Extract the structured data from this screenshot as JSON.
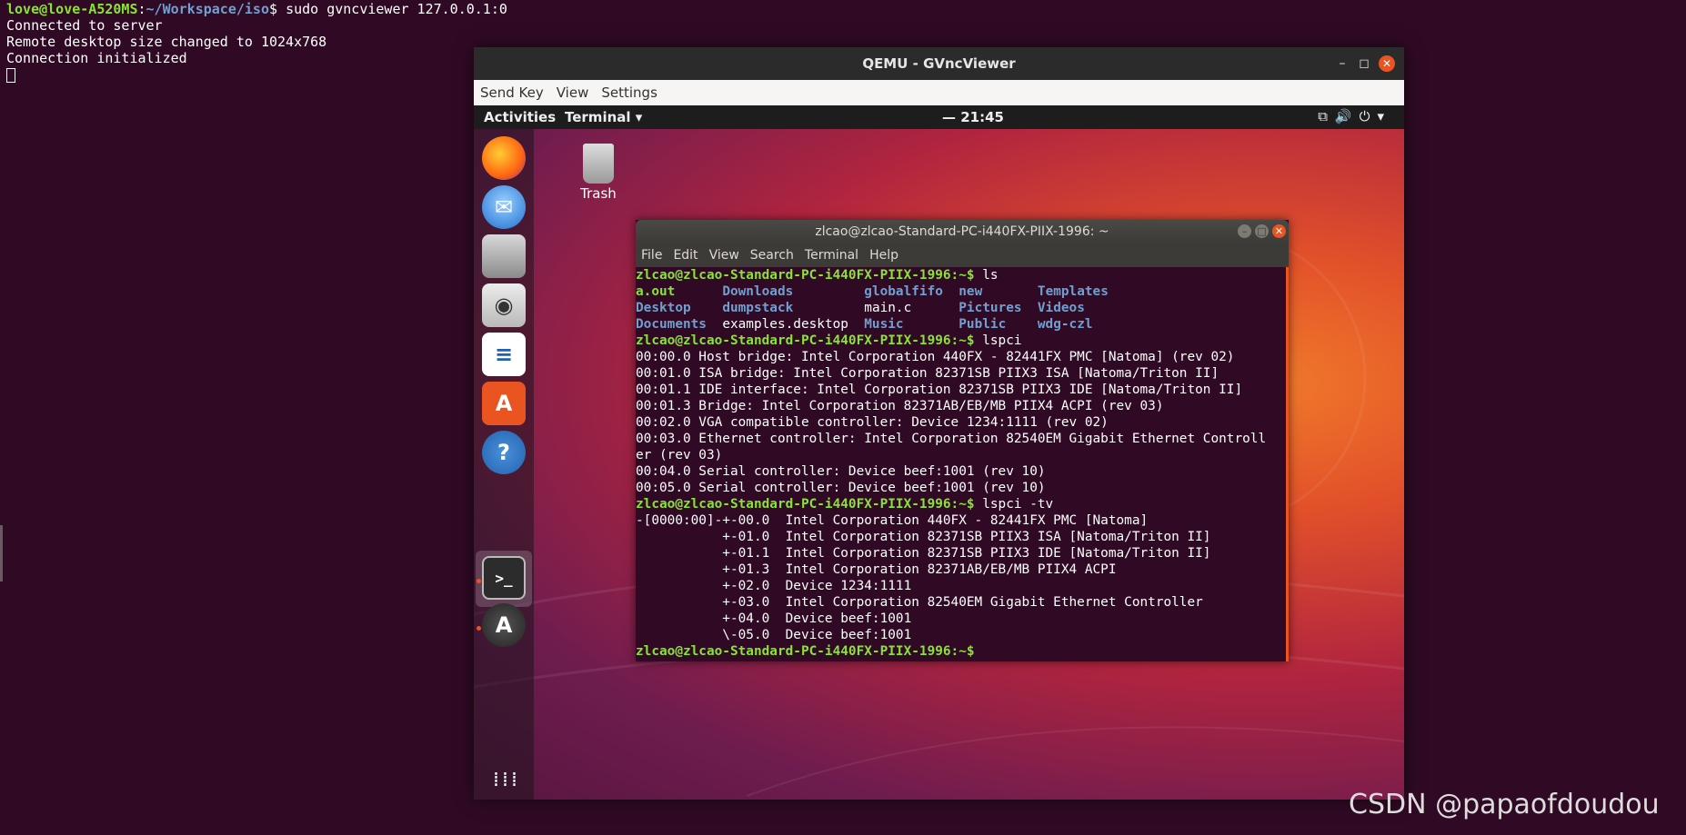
{
  "host_terminal": {
    "prompt_user": "love@love-A520MS",
    "prompt_sep": ":",
    "prompt_path": "~/Workspace/iso",
    "prompt_end": "$ ",
    "command": "sudo gvncviewer 127.0.0.1:0",
    "output": [
      "Connected to server",
      "Remote desktop size changed to 1024x768",
      "Connection initialized"
    ]
  },
  "vnc_window": {
    "title": "QEMU - GVncViewer",
    "menu": [
      "Send Key",
      "View",
      "Settings"
    ],
    "minimize": "–",
    "maximize": "◻",
    "close": "✕"
  },
  "guest_topbar": {
    "activities": "Activities",
    "app_menu": "Terminal ▾",
    "clock": "— 21:45",
    "tray": "⧉🔊⏻▾"
  },
  "desktop_icons": {
    "trash": "Trash"
  },
  "guest_terminal": {
    "title": "zlcao@zlcao-Standard-PC-i440FX-PIIX-1996: ~",
    "menu": [
      "File",
      "Edit",
      "View",
      "Search",
      "Terminal",
      "Help"
    ],
    "prompt": "zlcao@zlcao-Standard-PC-i440FX-PIIX-1996",
    "cmd_ls": "ls",
    "ls_rows": [
      [
        {
          "t": "a.out",
          "c": "green"
        },
        {
          "t": "Downloads",
          "c": "blue"
        },
        {
          "t": "globalfifo",
          "c": "blue"
        },
        {
          "t": "new",
          "c": "blue"
        },
        {
          "t": "Templates",
          "c": "blue"
        }
      ],
      [
        {
          "t": "Desktop",
          "c": "blue"
        },
        {
          "t": "dumpstack",
          "c": "blue"
        },
        {
          "t": "main.c",
          "c": "white"
        },
        {
          "t": "Pictures",
          "c": "blue"
        },
        {
          "t": "Videos",
          "c": "blue"
        }
      ],
      [
        {
          "t": "Documents",
          "c": "blue"
        },
        {
          "t": "examples.desktop",
          "c": "white"
        },
        {
          "t": "Music",
          "c": "blue"
        },
        {
          "t": "Public",
          "c": "blue"
        },
        {
          "t": "wdg-czl",
          "c": "blue"
        }
      ]
    ],
    "cmd_lspci": "lspci",
    "lspci_out": [
      "00:00.0 Host bridge: Intel Corporation 440FX - 82441FX PMC [Natoma] (rev 02)",
      "00:01.0 ISA bridge: Intel Corporation 82371SB PIIX3 ISA [Natoma/Triton II]",
      "00:01.1 IDE interface: Intel Corporation 82371SB PIIX3 IDE [Natoma/Triton II]",
      "00:01.3 Bridge: Intel Corporation 82371AB/EB/MB PIIX4 ACPI (rev 03)",
      "00:02.0 VGA compatible controller: Device 1234:1111 (rev 02)",
      "00:03.0 Ethernet controller: Intel Corporation 82540EM Gigabit Ethernet Controll",
      "er (rev 03)",
      "00:04.0 Serial controller: Device beef:1001 (rev 10)",
      "00:05.0 Serial controller: Device beef:1001 (rev 10)"
    ],
    "cmd_lspci_tv": "lspci -tv",
    "tree_out": [
      "-[0000:00]-+-00.0  Intel Corporation 440FX - 82441FX PMC [Natoma]",
      "           +-01.0  Intel Corporation 82371SB PIIX3 ISA [Natoma/Triton II]",
      "           +-01.1  Intel Corporation 82371SB PIIX3 IDE [Natoma/Triton II]",
      "           +-01.3  Intel Corporation 82371AB/EB/MB PIIX4 ACPI",
      "           +-02.0  Device 1234:1111",
      "           +-03.0  Intel Corporation 82540EM Gigabit Ethernet Controller",
      "           +-04.0  Device beef:1001",
      "           \\-05.0  Device beef:1001"
    ]
  },
  "watermark": "CSDN @papaofdoudou",
  "colors": {
    "ubuntu_orange": "#e95420",
    "term_bg": "#300a24",
    "prompt_green": "#8ae234",
    "dir_blue": "#729fcf"
  }
}
